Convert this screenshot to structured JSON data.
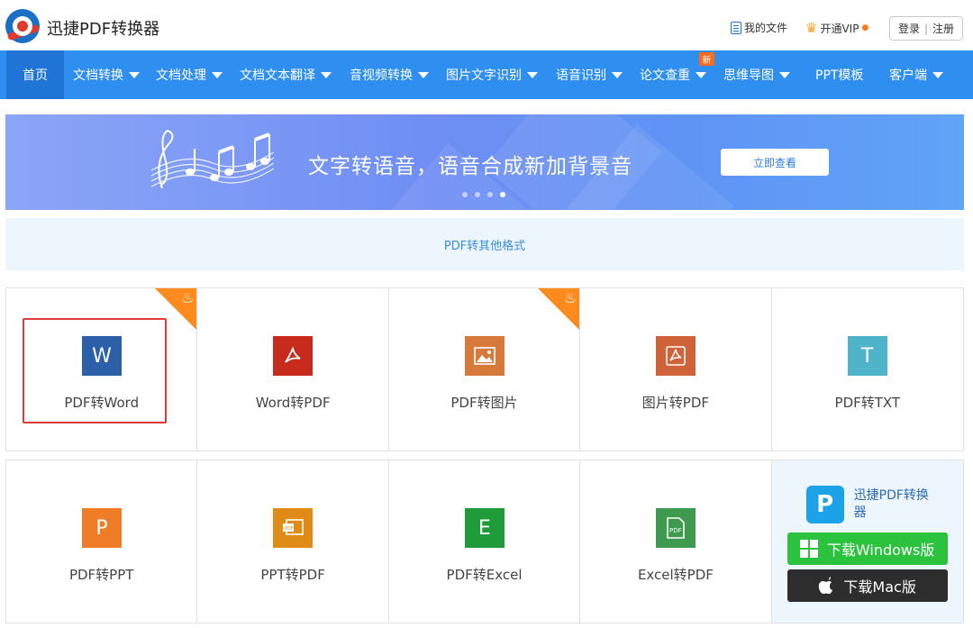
{
  "header": {
    "app_title": "迅捷PDF转换器",
    "my_files": "我的文件",
    "vip": "开通VIP",
    "login": "登录",
    "separator": "|",
    "register": "注册"
  },
  "nav": {
    "items": [
      {
        "label": "首页"
      },
      {
        "label": "文档转换"
      },
      {
        "label": "文档处理"
      },
      {
        "label": "文档文本翻译"
      },
      {
        "label": "音视频转换"
      },
      {
        "label": "图片文字识别"
      },
      {
        "label": "语音识别"
      },
      {
        "label": "论文查重"
      },
      {
        "label": "思维导图"
      },
      {
        "label": "PPT模板"
      },
      {
        "label": "客户端"
      }
    ],
    "new_badge": "新"
  },
  "banner": {
    "title": "文字转语音，语音合成新加背景音",
    "cta": "立即查看",
    "active_slide": 4,
    "slide_count": 4
  },
  "section": {
    "title": "PDF转其他格式"
  },
  "tools_row1": [
    {
      "label": "PDF转Word",
      "icon": "word-icon",
      "glyph": "W",
      "color": "#2b5fa8",
      "hot": true,
      "selected": true
    },
    {
      "label": "Word转PDF",
      "icon": "acrobat-icon",
      "glyph": "✒",
      "color": "#c62b1c",
      "hot": false
    },
    {
      "label": "PDF转图片",
      "icon": "image-icon",
      "glyph": "▲",
      "color": "#d67a3c",
      "hot": true
    },
    {
      "label": "图片转PDF",
      "icon": "pdf-icon",
      "glyph": "✒",
      "color": "#d0623a",
      "hot": false
    },
    {
      "label": "PDF转TXT",
      "icon": "txt-icon",
      "glyph": "T",
      "color": "#4fb3c9",
      "hot": false
    }
  ],
  "tools_row2": [
    {
      "label": "PDF转PPT",
      "icon": "ppt-icon",
      "glyph": "P",
      "color": "#f07c28"
    },
    {
      "label": "PPT转PDF",
      "icon": "ppt-pdf-icon",
      "glyph": "▣",
      "color": "#e08a18"
    },
    {
      "label": "PDF转Excel",
      "icon": "excel-icon",
      "glyph": "E",
      "color": "#1f9b3a"
    },
    {
      "label": "Excel转PDF",
      "icon": "excel-pdf-icon",
      "glyph": "▤",
      "color": "#3e9a4e"
    }
  ],
  "download": {
    "name": "迅捷PDF转换器",
    "windows": "下载Windows版",
    "mac": "下载Mac版"
  }
}
